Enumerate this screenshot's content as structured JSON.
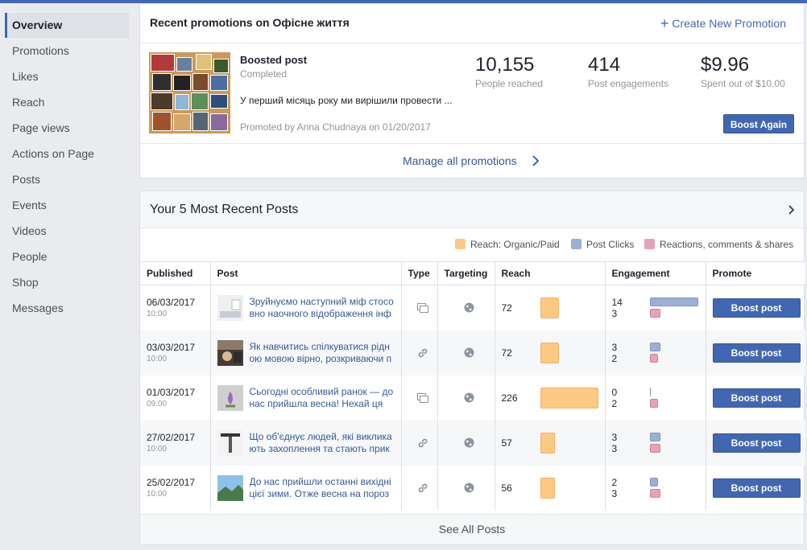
{
  "sidebar": {
    "items": [
      {
        "label": "Overview",
        "active": true
      },
      {
        "label": "Promotions"
      },
      {
        "label": "Likes"
      },
      {
        "label": "Reach"
      },
      {
        "label": "Page views"
      },
      {
        "label": "Actions on Page"
      },
      {
        "label": "Posts"
      },
      {
        "label": "Events"
      },
      {
        "label": "Videos"
      },
      {
        "label": "People"
      },
      {
        "label": "Shop"
      },
      {
        "label": "Messages"
      }
    ]
  },
  "promotions": {
    "title": "Recent promotions on Офісне життя",
    "create_label": "Create New Promotion",
    "boosted": {
      "title": "Boosted post",
      "status": "Completed",
      "text": "У перший місяць року ми вирішили провести ...",
      "promoted_by": "Promoted by Anna Chudnaya on 01/20/2017"
    },
    "stats": [
      {
        "value": "10,155",
        "label": "People reached"
      },
      {
        "value": "414",
        "label": "Post engagements"
      },
      {
        "value": "$9.96",
        "label": "Spent out of $10.00"
      }
    ],
    "boost_again_label": "Boost Again",
    "manage_label": "Manage all promotions"
  },
  "posts_section": {
    "title": "Your 5 Most Recent Posts",
    "legend": [
      {
        "label": "Reach: Organic/Paid",
        "color": "#fcc983"
      },
      {
        "label": "Post Clicks",
        "color": "#9cb0cf"
      },
      {
        "label": "Reactions, comments & shares",
        "color": "#e7a2b5"
      }
    ],
    "columns": [
      "Published",
      "Post",
      "Type",
      "Targeting",
      "Reach",
      "Engagement",
      "Promote"
    ],
    "rows": [
      {
        "date": "06/03/2017",
        "time": "10:00",
        "text": "Зруйнуємо наступний міф стосовно наочного відображення інф",
        "type": "album-icon",
        "reach": "72",
        "reach_value": 72,
        "clicks": "14",
        "clicks_value": 14,
        "reactions": "3",
        "reactions_value": 3,
        "promote": "Boost post",
        "thumb": "t1"
      },
      {
        "date": "03/03/2017",
        "time": "10:00",
        "text": "Як навчитись спілкуватися рідною мовою вірно, розкриваючи п",
        "type": "link-icon",
        "reach": "72",
        "reach_value": 72,
        "clicks": "3",
        "clicks_value": 3,
        "reactions": "2",
        "reactions_value": 2,
        "promote": "Boost post",
        "thumb": "t2"
      },
      {
        "date": "01/03/2017",
        "time": "09:00",
        "text": "Сьогодні особливий ранок — до нас прийшла весна! Нехай ця",
        "type": "album-icon",
        "reach": "226",
        "reach_value": 226,
        "clicks": "0",
        "clicks_value": 0,
        "reactions": "2",
        "reactions_value": 2,
        "promote": "Boost post",
        "thumb": "t3"
      },
      {
        "date": "27/02/2017",
        "time": "10:00",
        "text": "Що об'єднує людей, які викликають захоплення та стають прикл",
        "type": "link-icon",
        "reach": "57",
        "reach_value": 57,
        "clicks": "3",
        "clicks_value": 3,
        "reactions": "3",
        "reactions_value": 3,
        "promote": "Boost post",
        "thumb": "t4"
      },
      {
        "date": "25/02/2017",
        "time": "10:00",
        "text": "До нас прийшли останні вихідні цієї зими. Отже весна на пороз",
        "type": "link-icon",
        "reach": "56",
        "reach_value": 56,
        "clicks": "2",
        "clicks_value": 2,
        "reactions": "3",
        "reactions_value": 3,
        "promote": "Boost post",
        "thumb": "t5"
      }
    ],
    "see_all_label": "See All Posts"
  }
}
